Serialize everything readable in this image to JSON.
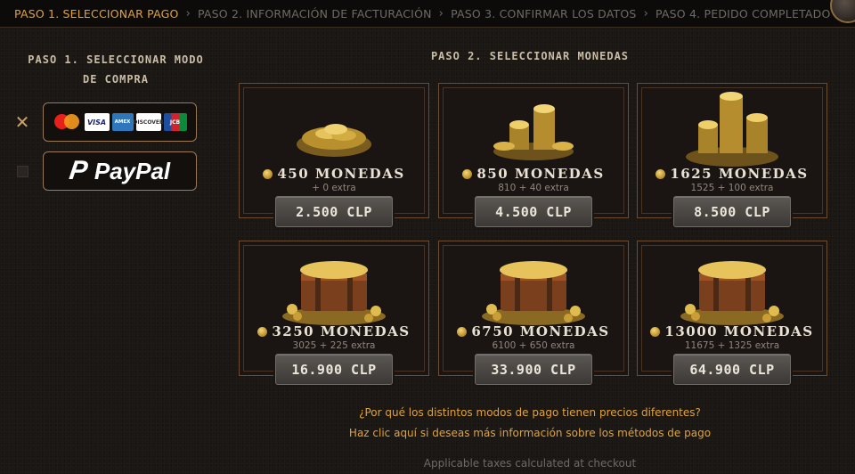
{
  "steps": [
    {
      "label": "PASO 1. SELECCIONAR PAGO",
      "active": true
    },
    {
      "label": "PASO 2. INFORMACIÓN DE FACTURACIÓN",
      "active": false
    },
    {
      "label": "PASO 3. CONFIRMAR LOS DATOS",
      "active": false
    },
    {
      "label": "PASO 4. PEDIDO COMPLETADO",
      "active": false
    }
  ],
  "left": {
    "title": "PASO 1. SELECCIONAR MODO DE COMPRA",
    "methods": [
      {
        "name": "cards",
        "selected": true,
        "logos": [
          "mastercard",
          "VISA",
          "AMERICAN EXPRESS",
          "DISCOVER",
          "JCB"
        ]
      },
      {
        "name": "paypal",
        "selected": false,
        "label": "PayPal",
        "mark": "P"
      }
    ]
  },
  "right": {
    "title": "PASO 2. SELECCIONAR MONEDAS",
    "packages": [
      {
        "coins": "450 MONEDAS",
        "extra": "+ 0 extra",
        "price": "2.500 CLP",
        "art": "pile"
      },
      {
        "coins": "850 MONEDAS",
        "extra": "810 + 40 extra",
        "price": "4.500 CLP",
        "art": "stacks"
      },
      {
        "coins": "1625 MONEDAS",
        "extra": "1525 + 100 extra",
        "price": "8.500 CLP",
        "art": "tower"
      },
      {
        "coins": "3250 MONEDAS",
        "extra": "3025 + 225 extra",
        "price": "16.900 CLP",
        "art": "chest"
      },
      {
        "coins": "6750 MONEDAS",
        "extra": "6100 + 650 extra",
        "price": "33.900 CLP",
        "art": "chest"
      },
      {
        "coins": "13000 MONEDAS",
        "extra": "11675 + 1325 extra",
        "price": "64.900 CLP",
        "art": "chest"
      }
    ]
  },
  "links": {
    "why_prices": "¿Por qué los distintos modos de pago tienen precios diferentes?",
    "more_info": "Haz clic aquí si deseas más información sobre los métodos de pago"
  },
  "footer": "Applicable taxes calculated at checkout",
  "colors": {
    "accent": "#e1a23a",
    "inactive_step": "#6f6a63",
    "frame": "#6e4c2f"
  }
}
